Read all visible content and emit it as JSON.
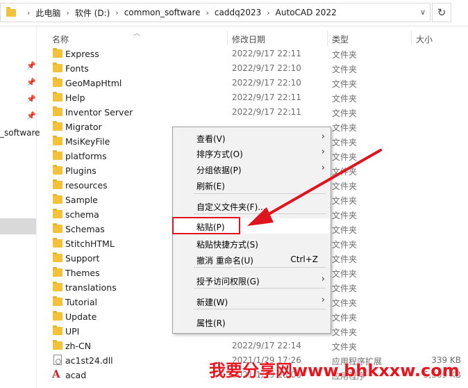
{
  "breadcrumb": [
    "此电脑",
    "软件 (D:)",
    "common_software",
    "caddq2023",
    "AutoCAD 2022"
  ],
  "columns": {
    "name": "名称",
    "date": "修改日期",
    "type": "类型",
    "size": "大小"
  },
  "nav": {
    "label": "_software"
  },
  "files": [
    {
      "name": "Express",
      "date": "2022/9/17 22:11",
      "type": "文件夹",
      "size": "",
      "kind": "folder"
    },
    {
      "name": "Fonts",
      "date": "2022/9/17 22:10",
      "type": "文件夹",
      "size": "",
      "kind": "folder"
    },
    {
      "name": "GeoMapHtml",
      "date": "2022/9/17 22:10",
      "type": "文件夹",
      "size": "",
      "kind": "folder"
    },
    {
      "name": "Help",
      "date": "2022/9/17 22:11",
      "type": "文件夹",
      "size": "",
      "kind": "folder"
    },
    {
      "name": "Inventor Server",
      "date": "2022/9/17 22:11",
      "type": "文件夹",
      "size": "",
      "kind": "folder"
    },
    {
      "name": "Migrator",
      "date": "",
      "type": "文件夹",
      "size": "",
      "kind": "folder"
    },
    {
      "name": "MsiKeyFile",
      "date": "",
      "type": "文件夹",
      "size": "",
      "kind": "folder"
    },
    {
      "name": "platforms",
      "date": "",
      "type": "文件夹",
      "size": "",
      "kind": "folder"
    },
    {
      "name": "Plugins",
      "date": "",
      "type": "文件夹",
      "size": "",
      "kind": "folder"
    },
    {
      "name": "resources",
      "date": "",
      "type": "文件夹",
      "size": "",
      "kind": "folder"
    },
    {
      "name": "Sample",
      "date": "",
      "type": "文件夹",
      "size": "",
      "kind": "folder"
    },
    {
      "name": "schema",
      "date": "",
      "type": "文件夹",
      "size": "",
      "kind": "folder"
    },
    {
      "name": "Schemas",
      "date": "",
      "type": "文件夹",
      "size": "",
      "kind": "folder"
    },
    {
      "name": "StitchHTML",
      "date": "",
      "type": "文件夹",
      "size": "",
      "kind": "folder"
    },
    {
      "name": "Support",
      "date": "",
      "type": "文件夹",
      "size": "",
      "kind": "folder"
    },
    {
      "name": "Themes",
      "date": "",
      "type": "文件夹",
      "size": "",
      "kind": "folder"
    },
    {
      "name": "translations",
      "date": "",
      "type": "文件夹",
      "size": "",
      "kind": "folder"
    },
    {
      "name": "Tutorial",
      "date": "",
      "type": "文件夹",
      "size": "",
      "kind": "folder"
    },
    {
      "name": "Update",
      "date": "",
      "type": "文件夹",
      "size": "",
      "kind": "folder"
    },
    {
      "name": "UPI",
      "date": "",
      "type": "文件夹",
      "size": "",
      "kind": "folder"
    },
    {
      "name": "zh-CN",
      "date": "2022/9/17 22:14",
      "type": "文件夹",
      "size": "",
      "kind": "folder"
    },
    {
      "name": "ac1st24.dll",
      "date": "2021/1/29 17:26",
      "type": "应用程序扩展",
      "size": "339 KB",
      "kind": "dll"
    },
    {
      "name": "acad",
      "date": "2021/1/29 18:06",
      "type": "应用程序",
      "size": "5,369 KB",
      "kind": "acad"
    }
  ],
  "context_menu": {
    "items": [
      {
        "label": "查看(V)",
        "submenu": true,
        "shortcut": ""
      },
      {
        "label": "排序方式(O)",
        "submenu": true,
        "shortcut": ""
      },
      {
        "label": "分组依据(P)",
        "submenu": true,
        "shortcut": ""
      },
      {
        "label": "刷新(E)",
        "submenu": false,
        "shortcut": ""
      },
      {
        "label": "自定义文件夹(F)...",
        "submenu": false,
        "shortcut": ""
      },
      {
        "label": "粘贴(P)",
        "submenu": false,
        "shortcut": ""
      },
      {
        "label": "粘贴快捷方式(S)",
        "submenu": false,
        "shortcut": ""
      },
      {
        "label": "撤消 重命名(U)",
        "submenu": false,
        "shortcut": "Ctrl+Z"
      },
      {
        "label": "授予访问权限(G)",
        "submenu": true,
        "shortcut": ""
      },
      {
        "label": "新建(W)",
        "submenu": true,
        "shortcut": ""
      },
      {
        "label": "属性(R)",
        "submenu": false,
        "shortcut": ""
      }
    ],
    "highlighted": "粘贴(P)"
  },
  "watermark": "我要分享网www.bhkxxw.com",
  "colors": {
    "folder": "#f3c13a",
    "annotation": "#e0141e",
    "menu_bg": "#f2f2f2"
  },
  "icons": {
    "refresh": "refresh-icon",
    "pin": "pin-icon",
    "folder": "folder-icon",
    "chevron": "chevron-right-icon"
  }
}
